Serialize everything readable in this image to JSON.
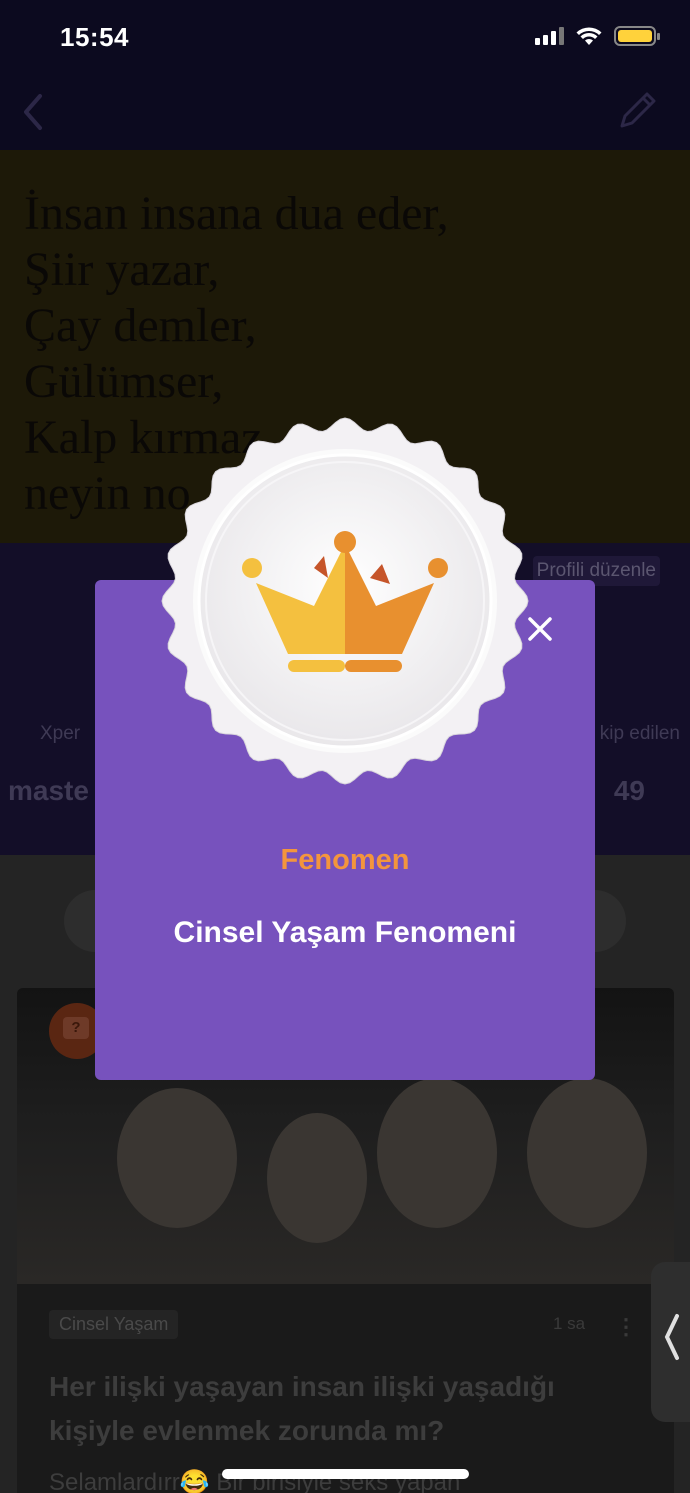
{
  "status_bar": {
    "time": "15:54",
    "icons": [
      "signal-icon",
      "wifi-icon",
      "battery-icon"
    ],
    "battery_color": "#ffd23b"
  },
  "nav": {
    "back_icon": "chevron-left-icon",
    "edit_icon": "pencil-icon"
  },
  "cover": {
    "lines": [
      "İnsan insana dua eder,",
      "Şiir yazar,",
      "Çay demler,",
      "Gülümser,",
      "Kalp kırmaz,",
      "neyin no"
    ]
  },
  "profile": {
    "edit_label": "Profili düzenle",
    "left_stat_label": "Xper",
    "right_stat_label": "kip edilen",
    "name_fragment": "maste",
    "right_stat_value": "49"
  },
  "feed": {
    "card": {
      "category": "Cinsel Yaşam",
      "time": "1 sa",
      "title": "Her ilişki yaşayan insan ilişki yaşadığı kişiyle evlenmek zorunda mı?",
      "excerpt": "Selamlardırr😂 Bir birisiyle seks yapan"
    }
  },
  "modal": {
    "title": "Fenomen",
    "subtitle": "Cinsel Yaşam Fenomeni",
    "close_icon": "close-icon",
    "medal_icon": "crown-icon",
    "colors": {
      "background": "#7752bd",
      "title": "#f3953d",
      "subtitle": "#ffffff",
      "crown_light": "#f4c03f",
      "crown_dark": "#e8902f"
    }
  }
}
